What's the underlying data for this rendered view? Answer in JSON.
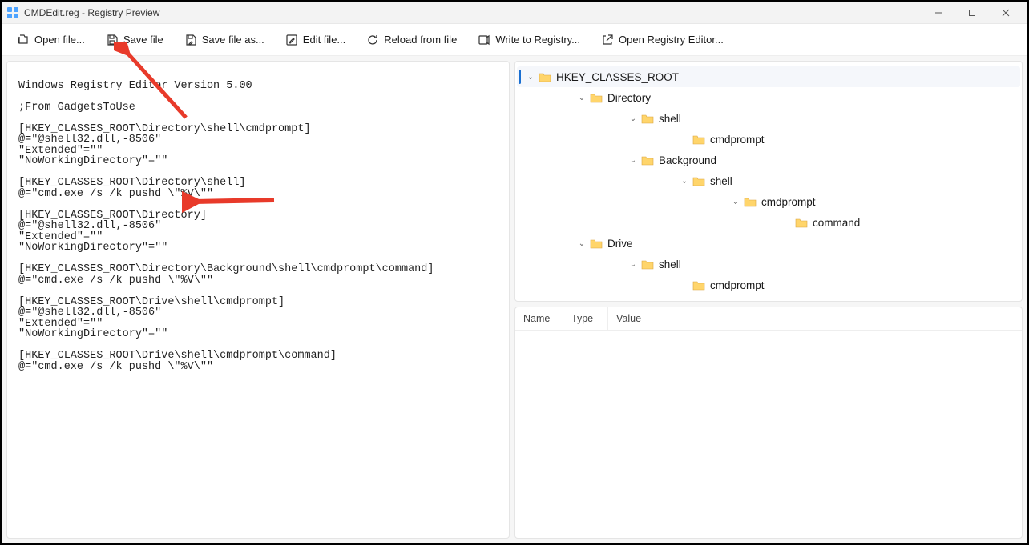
{
  "titlebar": {
    "title": "CMDEdit.reg - Registry Preview"
  },
  "toolbar": {
    "open_file": "Open file...",
    "save_file": "Save file",
    "save_file_as": "Save file as...",
    "edit_file": "Edit file...",
    "reload": "Reload from file",
    "write_registry": "Write to Registry...",
    "open_regedit": "Open Registry Editor..."
  },
  "editor": {
    "content": "Windows Registry Editor Version 5.00\n\n;From GadgetsToUse\n\n[HKEY_CLASSES_ROOT\\Directory\\shell\\cmdprompt]\n@=\"@shell32.dll,-8506\"\n\"Extended\"=\"\"\n\"NoWorkingDirectory\"=\"\"\n\n[HKEY_CLASSES_ROOT\\Directory\\shell]\n@=\"cmd.exe /s /k pushd \\\"%V\\\"\"\n\n[HKEY_CLASSES_ROOT\\Directory]\n@=\"@shell32.dll,-8506\"\n\"Extended\"=\"\"\n\"NoWorkingDirectory\"=\"\"\n\n[HKEY_CLASSES_ROOT\\Directory\\Background\\shell\\cmdprompt\\command]\n@=\"cmd.exe /s /k pushd \\\"%V\\\"\"\n\n[HKEY_CLASSES_ROOT\\Drive\\shell\\cmdprompt]\n@=\"@shell32.dll,-8506\"\n\"Extended\"=\"\"\n\"NoWorkingDirectory\"=\"\"\n\n[HKEY_CLASSES_ROOT\\Drive\\shell\\cmdprompt\\command]\n@=\"cmd.exe /s /k pushd \\\"%V\\\"\""
  },
  "tree": {
    "root": "HKEY_CLASSES_ROOT",
    "n0": "Directory",
    "n0_0": "shell",
    "n0_0_0": "cmdprompt",
    "n0_1": "Background",
    "n0_1_0": "shell",
    "n0_1_0_0": "cmdprompt",
    "n0_1_0_0_0": "command",
    "n1": "Drive",
    "n1_0": "shell",
    "n1_0_0": "cmdprompt"
  },
  "table": {
    "col_name": "Name",
    "col_type": "Type",
    "col_value": "Value"
  }
}
